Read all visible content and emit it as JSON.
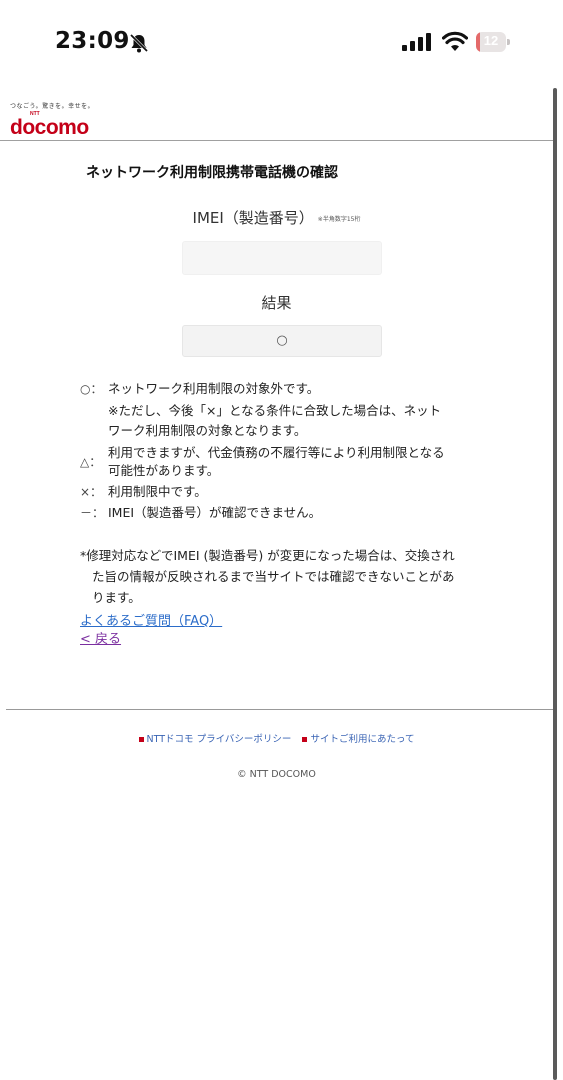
{
  "status_bar": {
    "time": "23:09",
    "battery": "12",
    "battery_fraction": 0.12,
    "battery_color": "#e46a6a"
  },
  "header": {
    "tagline": "つなごう。驚きを。幸せを。",
    "ntt": "NTT",
    "logo": "docomo",
    "brand_color": "#c40018"
  },
  "page": {
    "title": "ネットワーク利用制限携帯電話機の確認",
    "imei_label": "IMEI（製造番号）",
    "imei_note": "※半角数字15桁",
    "imei_value": "",
    "result_label": "結果",
    "result_value": "○"
  },
  "legend": [
    {
      "symbol": "○：",
      "lines": [
        "ネットワーク利用制限の対象外です。",
        "※ただし、今後「×」となる条件に合致した場合は、ネット",
        "ワーク利用制限の対象となります。"
      ]
    },
    {
      "symbol": "△：",
      "lines": [
        "利用できますが、代金債務の不履行等により利用制限となる",
        "可能性があります。"
      ]
    },
    {
      "symbol": "×：",
      "lines": [
        "利用制限中です。"
      ]
    },
    {
      "symbol": "－：",
      "lines": [
        "IMEI（製造番号）が確認できません。"
      ]
    }
  ],
  "note": [
    "*修理対応などでIMEI (製造番号) が変更になった場合は、交換され",
    "た旨の情報が反映されるまで当サイトでは確認できないことがあ",
    "ります。"
  ],
  "links": {
    "faq": "よくあるご質問（FAQ）",
    "back": "< 戻る"
  },
  "footer": {
    "privacy": "NTTドコモ プライバシーポリシー",
    "terms": "サイトご利用にあたって",
    "copyright": "© NTT DOCOMO"
  }
}
